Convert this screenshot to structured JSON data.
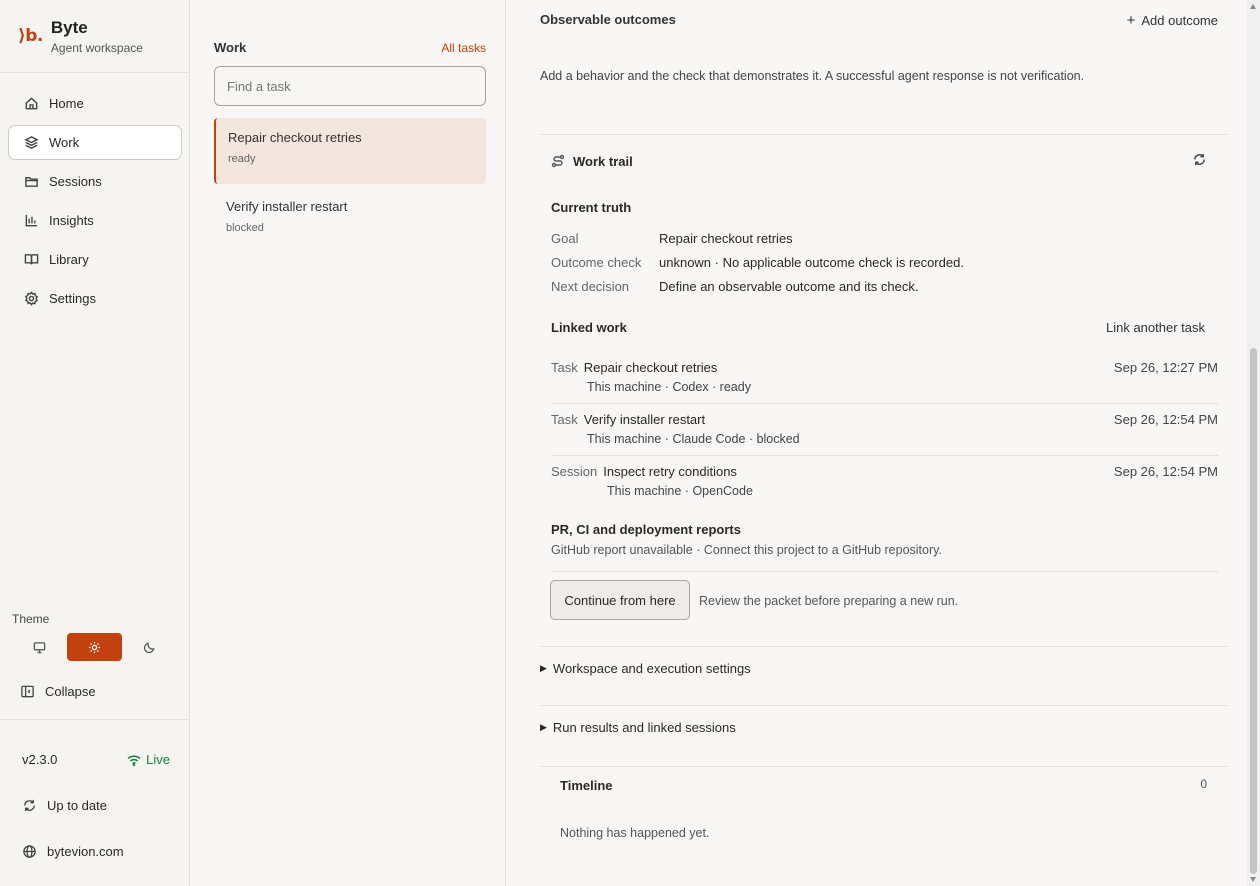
{
  "brand": {
    "logo": "⟩b.",
    "name": "Byte",
    "subtitle": "Agent workspace"
  },
  "nav": [
    {
      "label": "Home",
      "icon": "home-icon",
      "active": false
    },
    {
      "label": "Work",
      "icon": "layers-icon",
      "active": true
    },
    {
      "label": "Sessions",
      "icon": "folder-icon",
      "active": false
    },
    {
      "label": "Insights",
      "icon": "bar-chart-icon",
      "active": false
    },
    {
      "label": "Library",
      "icon": "book-icon",
      "active": false
    },
    {
      "label": "Settings",
      "icon": "gear-icon",
      "active": false
    }
  ],
  "theme": {
    "label": "Theme",
    "options": [
      "system",
      "light",
      "dark"
    ],
    "selected": "light"
  },
  "collapse_label": "Collapse",
  "footer": {
    "version": "v2.3.0",
    "status": "Live",
    "update": "Up to date",
    "site": "bytevion.com"
  },
  "tasks": {
    "title": "Work",
    "all_tasks": "All tasks",
    "search_placeholder": "Find a task",
    "items": [
      {
        "name": "Repair checkout retries",
        "status": "ready",
        "selected": true
      },
      {
        "name": "Verify installer restart",
        "status": "blocked",
        "selected": false
      }
    ]
  },
  "outcomes": {
    "title": "Observable outcomes",
    "add_label": "Add outcome",
    "description": "Add a behavior and the check that demonstrates it. A successful agent response is not verification."
  },
  "work_trail": {
    "title": "Work trail",
    "current_truth": {
      "title": "Current truth",
      "rows": [
        {
          "key": "Goal",
          "value": "Repair checkout retries"
        },
        {
          "key": "Outcome check",
          "value": "unknown · No applicable outcome check is recorded."
        },
        {
          "key": "Next decision",
          "value": "Define an observable outcome and its check."
        }
      ]
    },
    "linked_work": {
      "title": "Linked work",
      "link_label": "Link another task",
      "items": [
        {
          "kind": "Task",
          "title": "Repair checkout retries",
          "sub": "This machine · Codex · ready",
          "date": "Sep 26, 12:27 PM"
        },
        {
          "kind": "Task",
          "title": "Verify installer restart",
          "sub": "This machine · Claude Code · blocked",
          "date": "Sep 26, 12:54 PM"
        },
        {
          "kind": "Session",
          "title": "Inspect retry conditions",
          "sub": "This machine · OpenCode",
          "date": "Sep 26, 12:54 PM"
        }
      ]
    },
    "reports": {
      "title": "PR, CI and deployment reports",
      "description": "GitHub report unavailable · Connect this project to a GitHub repository."
    },
    "continue_label": "Continue from here",
    "continue_note": "Review the packet before preparing a new run."
  },
  "sections": {
    "workspace": "Workspace and execution settings",
    "results": "Run results and linked sessions"
  },
  "timeline": {
    "title": "Timeline",
    "count": "0",
    "empty": "Nothing has happened yet."
  },
  "colors": {
    "accent": "#c2410c",
    "live": "#15803d"
  }
}
